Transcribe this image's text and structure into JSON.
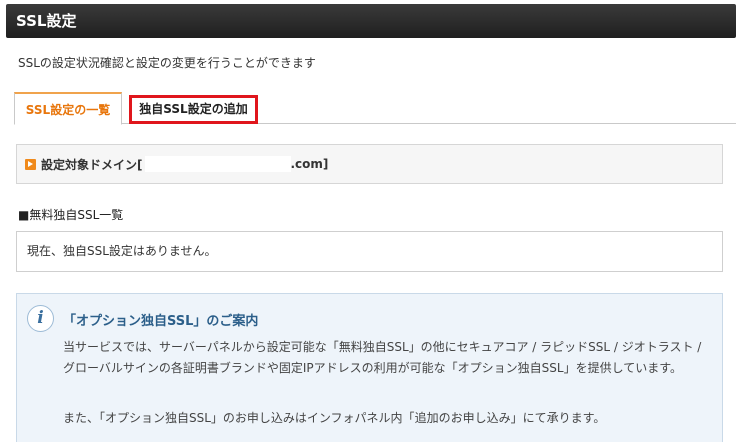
{
  "header": {
    "title": "SSL設定"
  },
  "description": "SSLの設定状況確認と設定の変更を行うことができます",
  "tabs": [
    {
      "label": "SSL設定の一覧",
      "active": true
    },
    {
      "label": "独自SSL設定の追加",
      "active": false
    }
  ],
  "domain": {
    "label": "設定対象ドメイン[",
    "suffix": ".com]"
  },
  "ssl_list": {
    "title": "■無料独自SSL一覧",
    "empty_message": "現在、独自SSL設定はありません。"
  },
  "info": {
    "title": "「オプション独自SSL」のご案内",
    "paragraph1": "当サービスでは、サーバーパネルから設定可能な「無料独自SSL」の他にセキュアコア / ラピッドSSL / ジオトラスト / グローバルサインの各証明書ブランドや固定IPアドレスの利用が可能な「オプション独自SSL」を提供しています。",
    "paragraph2": "また、「オプション独自SSL」のお申し込みはインフォパネル内「追加のお申し込み」にて承ります。"
  },
  "colors": {
    "accent": "#e8760c",
    "highlight_border": "#e0161c",
    "info_bg": "#eef4fa"
  }
}
